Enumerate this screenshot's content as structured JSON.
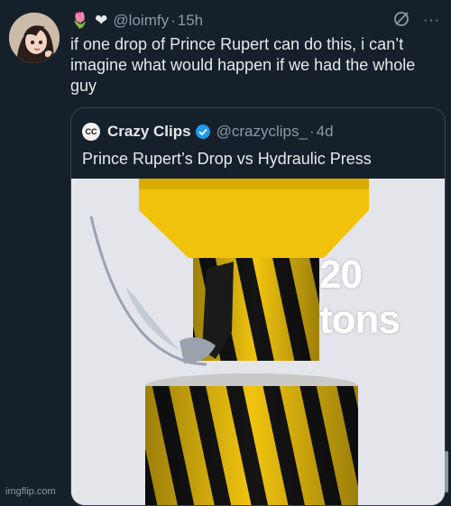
{
  "author": {
    "name_emojis": [
      "🌷",
      "❤"
    ],
    "handle": "@loimfy",
    "separator": "·",
    "time": "15h"
  },
  "tweet": {
    "text": "if one drop of Prince Rupert can do this, i can’t imagine what would happen if we had the whole guy"
  },
  "header_actions": {
    "grok_icon": "slashed-circle-icon",
    "more_label": "···"
  },
  "quote": {
    "logo_text": "CC",
    "name": "Crazy Clips",
    "handle": "@crazyclips_",
    "separator": "·",
    "time": "4d",
    "text": "Prince Rupert’s Drop vs Hydraulic Press",
    "media_overlay": "20 tons",
    "verified_color": "#1d9bf0"
  },
  "watermark": "imgflip.com",
  "colors": {
    "background": "#15202b",
    "text": "#e7e9ea",
    "muted": "#8b98a5",
    "border": "#38444d",
    "press_yellow": "#f1c40f"
  }
}
